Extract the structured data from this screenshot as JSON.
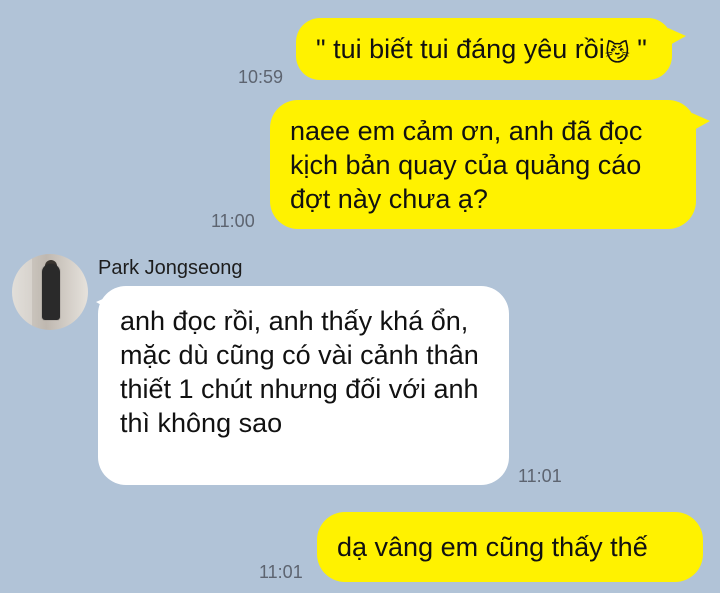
{
  "conversation": {
    "contact_name": "Park Jongseong",
    "messages": [
      {
        "side": "outgoing",
        "time": "10:59",
        "text_parts": [
          "\" tui biết tui đáng yêu rồi",
          "😼",
          " \""
        ]
      },
      {
        "side": "outgoing",
        "time": "11:00",
        "text": "naee em cảm ơn, anh đã đọc kịch bản quay của quảng cáo đợt này chưa ạ?"
      },
      {
        "side": "incoming",
        "time": "11:01",
        "text": "anh đọc rồi, anh thấy khá ổn, mặc dù cũng có vài cảnh thân thiết 1 chút nhưng đối với anh thì không sao"
      },
      {
        "side": "outgoing",
        "time": "11:01",
        "text": "dạ vâng em cũng thấy thế"
      }
    ]
  },
  "colors": {
    "background": "#b1c3d7",
    "outgoing_bubble": "#fff200",
    "incoming_bubble": "#ffffff",
    "time_text": "#5d6470"
  }
}
